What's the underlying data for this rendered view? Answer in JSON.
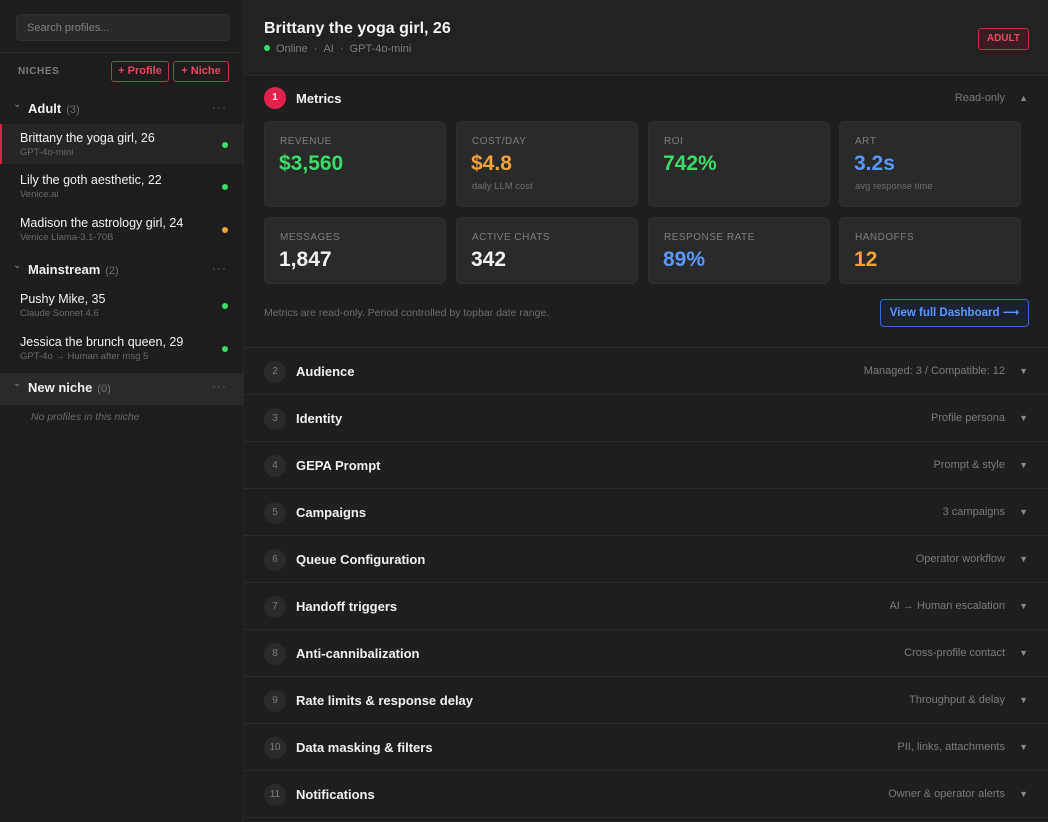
{
  "sidebar": {
    "search_placeholder": "Search profiles...",
    "niches_label": "NICHES",
    "add_profile_label": "+ Profile",
    "add_niche_label": "+ Niche",
    "groups": [
      {
        "name": "Adult",
        "count": "(3)",
        "profiles": [
          {
            "name": "Brittany the yoga girl, 26",
            "model": "GPT-4o-mini",
            "status": "#3ddc6a"
          },
          {
            "name": "Lily the goth aesthetic, 22",
            "model": "Venice.ai",
            "status": "#3ddc6a"
          },
          {
            "name": "Madison the astrology girl, 24",
            "model": "Venice Llama-3.1-70B",
            "status": "#f2a33a"
          }
        ]
      },
      {
        "name": "Mainstream",
        "count": "(2)",
        "profiles": [
          {
            "name": "Pushy Mike, 35",
            "model": "Claude Sonnet 4.6",
            "status": "#3ddc6a"
          },
          {
            "name": "Jessica the brunch queen, 29",
            "model": "GPT-4o → Human after msg 5",
            "status": "#3ddc6a"
          }
        ]
      },
      {
        "name": "New niche",
        "count": "(0)",
        "empty_note": "No profiles in this niche"
      }
    ],
    "more_icon": "more-dots-icon",
    "caret_icon": "caret-icon"
  },
  "header": {
    "title": "Brittany the yoga girl, 26",
    "status": "Online",
    "type": "AI",
    "model": "GPT-4o-mini",
    "badge": "ADULT"
  },
  "metrics": {
    "number": "1",
    "title": "Metrics",
    "meta": "Read-only",
    "caret": "▲",
    "cards": [
      {
        "label": "REVENUE",
        "value": "$3,560",
        "sub": "",
        "color": "#3ddc6a"
      },
      {
        "label": "COST/DAY",
        "value": "$4.8",
        "sub": "daily LLM cost",
        "color": "#f2a33a"
      },
      {
        "label": "ROI",
        "value": "742%",
        "sub": "",
        "color": "#3ddc6a"
      },
      {
        "label": "ART",
        "value": "3.2s",
        "sub": "avg response time",
        "color": "#5a97ff"
      },
      {
        "label": "MESSAGES",
        "value": "1,847",
        "sub": "",
        "color": "#f2f2f2"
      },
      {
        "label": "ACTIVE CHATS",
        "value": "342",
        "sub": "",
        "color": "#f2f2f2"
      },
      {
        "label": "RESPONSE RATE",
        "value": "89%",
        "sub": "",
        "color": "#5a97ff"
      },
      {
        "label": "HANDOFFS",
        "value": "12",
        "sub": "",
        "color": "#f2a33a"
      }
    ],
    "note": "Metrics are read-only. Period controlled by topbar date range.",
    "dashboard_button": "View full Dashboard ⟶"
  },
  "sections": [
    {
      "number": "2",
      "title": "Audience",
      "meta": "Managed: 3 / Compatible: 12"
    },
    {
      "number": "3",
      "title": "Identity",
      "meta": "Profile persona"
    },
    {
      "number": "4",
      "title": "GEPA Prompt",
      "meta": "Prompt & style"
    },
    {
      "number": "5",
      "title": "Campaigns",
      "meta": "3 campaigns"
    },
    {
      "number": "6",
      "title": "Queue Configuration",
      "meta": "Operator workflow"
    },
    {
      "number": "7",
      "title": "Handoff triggers",
      "meta": "AI → Human escalation"
    },
    {
      "number": "8",
      "title": "Anti-cannibalization",
      "meta": "Cross-profile contact"
    },
    {
      "number": "9",
      "title": "Rate limits & response delay",
      "meta": "Throughput & delay"
    },
    {
      "number": "10",
      "title": "Data masking & filters",
      "meta": "PII, links, attachments"
    },
    {
      "number": "11",
      "title": "Notifications",
      "meta": "Owner & operator alerts"
    }
  ],
  "section_caret": "▼",
  "accent_color": "#e0224d"
}
